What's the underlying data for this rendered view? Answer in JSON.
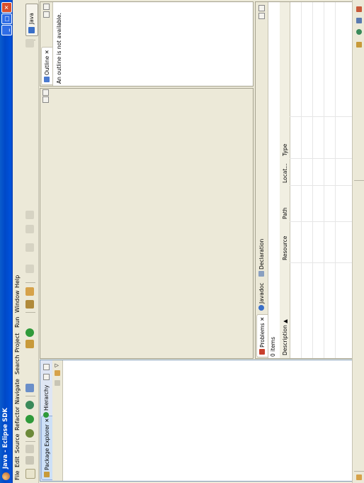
{
  "window": {
    "title": "Java - Eclipse SDK"
  },
  "menu": [
    "File",
    "Edit",
    "Source",
    "Refactor",
    "Navigate",
    "Search",
    "Project",
    "Run",
    "Window",
    "Help"
  ],
  "perspective": {
    "label": "Java"
  },
  "package_explorer": {
    "tabs": [
      "Package Explorer",
      "Hierarchy"
    ]
  },
  "outline": {
    "tab": "Outline",
    "message": "An outline is not available."
  },
  "bottom": {
    "tabs": [
      "Problems",
      "Javadoc",
      "Declaration"
    ],
    "items": "0 items",
    "columns": [
      "Description",
      "Resource",
      "Path",
      "Locat...",
      "Type"
    ]
  },
  "icon_names": [
    "new-icon",
    "save-icon",
    "print-icon",
    "debug-icon",
    "run-icon",
    "external-tools-icon",
    "new-java-project-icon",
    "new-package-icon",
    "new-class-icon",
    "open-type-icon",
    "search-icon",
    "annotation-next-icon",
    "back-icon",
    "forward-icon",
    "open-perspective-icon",
    "java-perspective-icon"
  ]
}
